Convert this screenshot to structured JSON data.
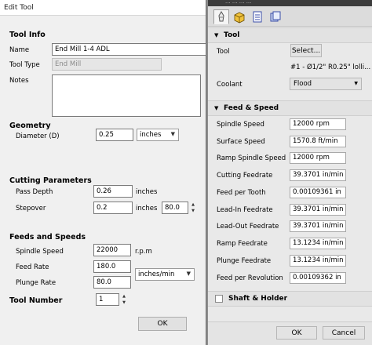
{
  "edit_tool": {
    "title": "Edit Tool",
    "tool_info": {
      "heading": "Tool Info",
      "name_label": "Name",
      "name_value": "End Mill 1-4 ADL",
      "type_label": "Tool Type",
      "type_value": "End Mill",
      "notes_label": "Notes",
      "notes_value": ""
    },
    "geometry": {
      "heading": "Geometry",
      "diameter_label": "Diameter (D)",
      "diameter_value": "0.25",
      "units": "inches"
    },
    "cutting_parameters": {
      "heading": "Cutting Parameters",
      "pass_depth_label": "Pass Depth",
      "pass_depth_value": "0.26",
      "pass_depth_unit": "inches",
      "stepover_label": "Stepover",
      "stepover_value": "0.2",
      "stepover_unit": "inches",
      "stepover_percent": "80.0"
    },
    "feeds_and_speeds": {
      "heading": "Feeds and Speeds",
      "spindle_speed_label": "Spindle Speed",
      "spindle_speed_value": "22000",
      "spindle_speed_unit": "r.p.m",
      "feed_rate_label": "Feed Rate",
      "feed_rate_value": "180.0",
      "plunge_rate_label": "Plunge Rate",
      "plunge_rate_value": "80.0",
      "rate_units": "inches/min"
    },
    "tool_number": {
      "label": "Tool Number",
      "value": "1"
    },
    "ok_label": "OK"
  },
  "tool_panel": {
    "title_fragment": "... ... ... ...",
    "tabs": [
      {
        "icon": "tool-tab-icon",
        "active": true
      },
      {
        "icon": "cube-tab-icon",
        "active": false
      },
      {
        "icon": "document-tab-icon",
        "active": false
      },
      {
        "icon": "stack-tab-icon",
        "active": false
      }
    ],
    "tool_section": {
      "heading": "Tool",
      "tool_label": "Tool",
      "select_label": "Select...",
      "tool_description": "#1 - Ø1/2\" R0.25\" lolli...",
      "coolant_label": "Coolant",
      "coolant_value": "Flood"
    },
    "feed_speed": {
      "heading": "Feed & Speed",
      "rows": [
        {
          "label": "Spindle Speed",
          "value": "12000 rpm"
        },
        {
          "label": "Surface Speed",
          "value": "1570.8 ft/min"
        },
        {
          "label": "Ramp Spindle Speed",
          "value": "12000 rpm"
        },
        {
          "label": "Cutting Feedrate",
          "value": "39.3701 in/min"
        },
        {
          "label": "Feed per Tooth",
          "value": "0.00109361 in"
        },
        {
          "label": "Lead-In Feedrate",
          "value": "39.3701 in/min"
        },
        {
          "label": "Lead-Out Feedrate",
          "value": "39.3701 in/min"
        },
        {
          "label": "Ramp Feedrate",
          "value": "13.1234 in/min"
        },
        {
          "label": "Plunge Feedrate",
          "value": "13.1234 in/min"
        },
        {
          "label": "Feed per Revolution",
          "value": "0.00109362 in"
        }
      ]
    },
    "shaft_holder": {
      "label": "Shaft & Holder",
      "checked": false
    },
    "ok_label": "OK",
    "cancel_label": "Cancel"
  }
}
